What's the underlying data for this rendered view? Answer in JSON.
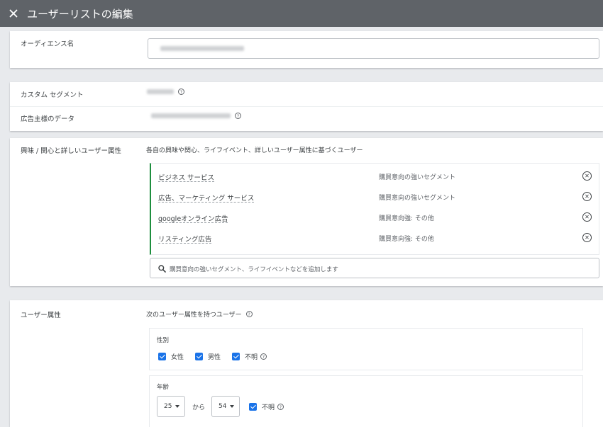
{
  "header": {
    "title": "ユーザーリストの編集"
  },
  "audience": {
    "label": "オーディエンス名"
  },
  "custom_segment": {
    "label": "カスタム セグメント"
  },
  "advertiser_data": {
    "label": "広告主様のデータ"
  },
  "interests": {
    "label": "興味 / 関心と詳しいユーザー属性",
    "description": "各自の興味や関心、ライフイベント、詳しいユーザー属性に基づくユーザー",
    "segments": [
      {
        "name": "ビジネス サービス",
        "type": "購買意向の強いセグメント"
      },
      {
        "name": "広告、マーケティング サービス",
        "type": "購買意向の強いセグメント"
      },
      {
        "name": "googleオンライン広告",
        "type": "購買意向強: その他"
      },
      {
        "name": "リスティング広告",
        "type": "購買意向強: その他"
      }
    ],
    "search_placeholder": "購買意向の強いセグメント、ライフイベントなどを追加します"
  },
  "demographics": {
    "label": "ユーザー属性",
    "description": "次のユーザー属性を持つユーザー",
    "gender": {
      "title": "性別",
      "options": [
        {
          "label": "女性",
          "checked": true
        },
        {
          "label": "男性",
          "checked": true
        },
        {
          "label": "不明",
          "checked": true
        }
      ]
    },
    "age": {
      "title": "年齢",
      "from": "25",
      "connector": "から",
      "to": "54",
      "unknown_label": "不明"
    }
  }
}
